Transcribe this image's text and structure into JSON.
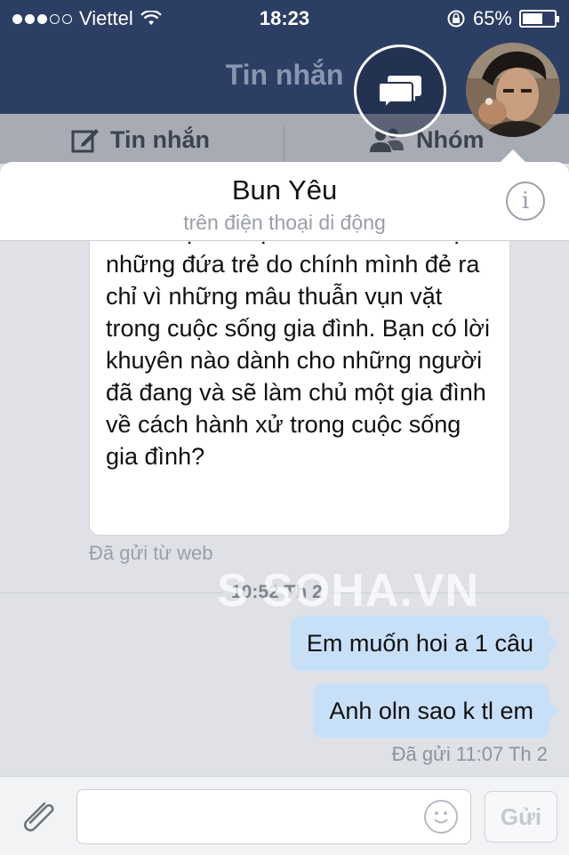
{
  "status_bar": {
    "carrier": "Viettel",
    "time": "18:23",
    "battery": "65%",
    "battery_level": 0.65,
    "signal_dots_filled": 3,
    "signal_dots_total": 5
  },
  "nav": {
    "title": "Tin nhắn"
  },
  "tabs": [
    {
      "label": "Tin nhắn",
      "icon": "compose-icon"
    },
    {
      "label": "Nhóm",
      "icon": "group-icon"
    }
  ],
  "conversation": {
    "contact_name": "Bun Yêu",
    "contact_status": "trên điện thoại di động",
    "incoming_text": "nhiều vụ bố mẹ nhẫn tâm hãm hại những đứa trẻ do chính mình đẻ ra chỉ vì những mâu thuẫn vụn vặt trong cuộc sống gia đình. Bạn có lời khuyên nào dành cho những người đã đang và sẽ làm chủ một gia đình về cách hành xử trong cuộc sống gia đình?",
    "incoming_meta": "Đã gửi từ web",
    "separator_time": "10:52 Th 2",
    "outgoing": [
      {
        "text": "Em muốn hoi a 1 câu"
      },
      {
        "text": "Anh oln sao k tl em"
      }
    ],
    "outgoing_meta": "Đã gửi 11:07 Th 2"
  },
  "watermark": "SOHA.VN",
  "composer": {
    "send_label": "Gửi",
    "input_value": ""
  },
  "colors": {
    "nav_bg": "#2c3e63",
    "outgoing_bubble": "#c8dff8",
    "chat_bg": "#dfe1e6"
  }
}
